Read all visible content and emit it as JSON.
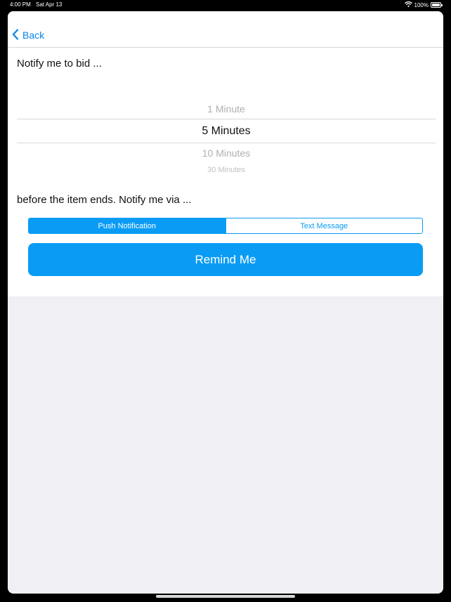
{
  "status_bar": {
    "time": "4:00 PM",
    "date": "Sat Apr 13",
    "battery": "100%",
    "icons": [
      "wifi-icon",
      "battery-icon"
    ]
  },
  "navbar": {
    "back_label": "Back",
    "back_icon": "chevron-left-icon"
  },
  "prompt_top": "Notify me to bid ...",
  "picker": {
    "options": [
      "1 Minute",
      "5 Minutes",
      "10 Minutes",
      "30 Minutes"
    ],
    "selected": "5 Minutes"
  },
  "prompt_bottom": "before the item ends. Notify me via ...",
  "segmented": {
    "options": [
      "Push Notification",
      "Text Message"
    ],
    "selected": "Push Notification"
  },
  "remind_button": "Remind Me",
  "colors": {
    "accent": "#0a9cf5",
    "link": "#0a84e8",
    "background": "#efeff4"
  }
}
